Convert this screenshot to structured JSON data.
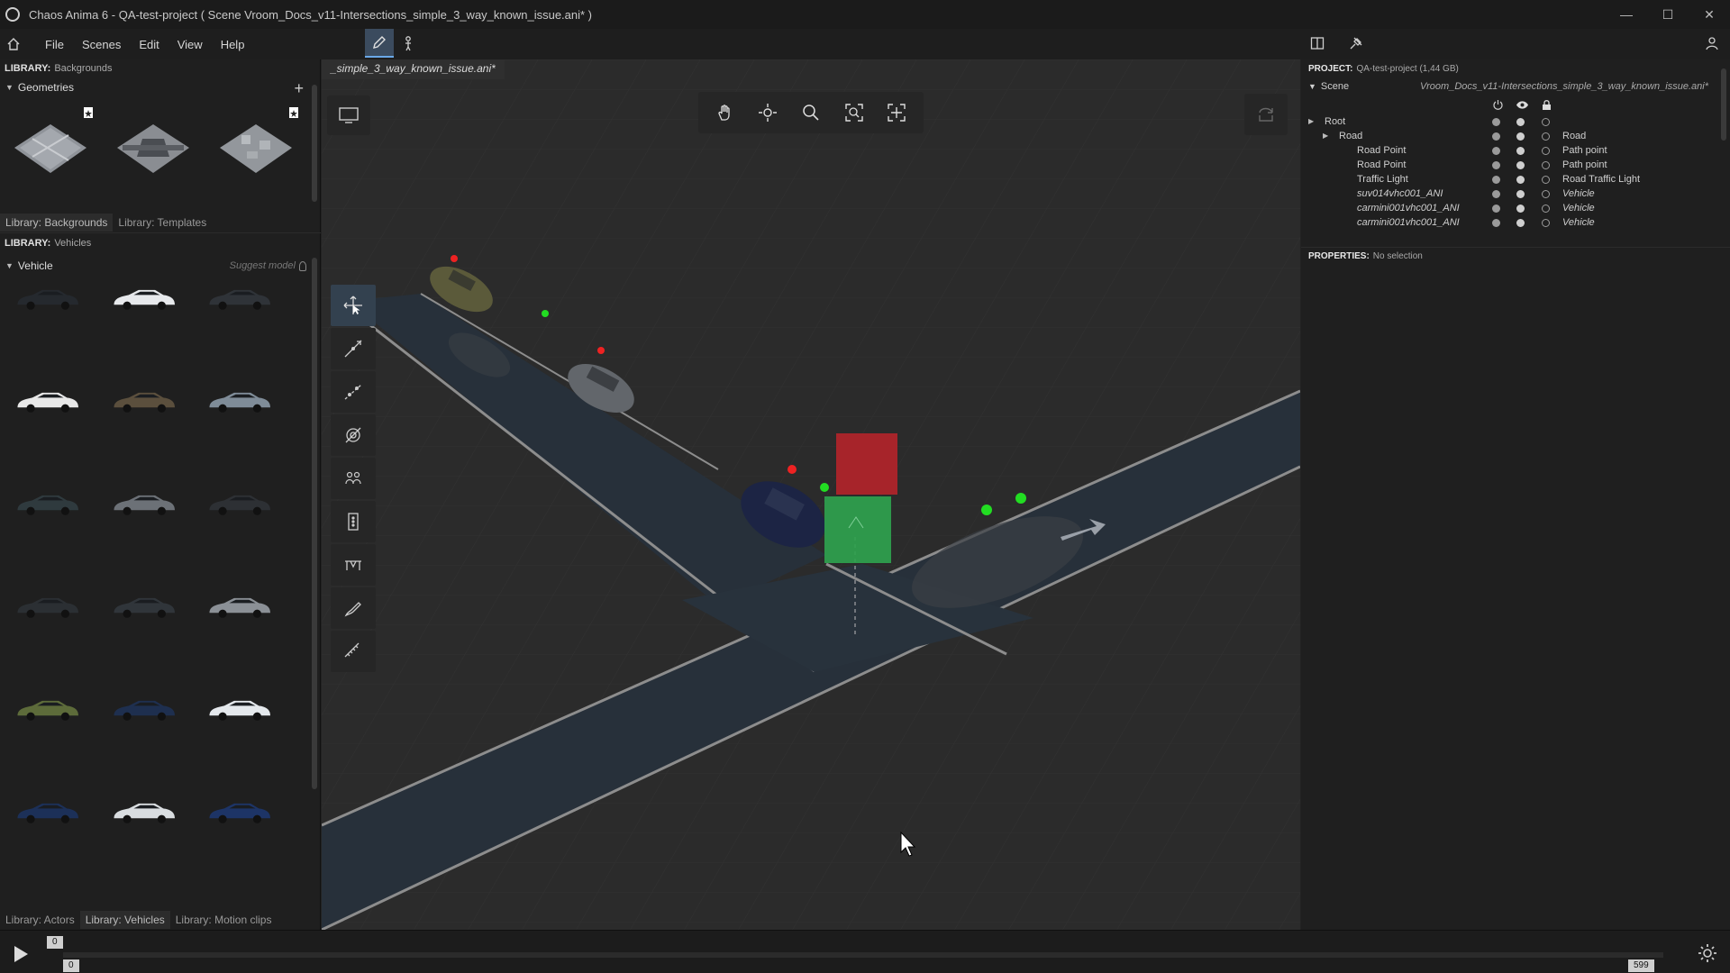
{
  "window": {
    "title": "Chaos Anima 6 - QA-test-project ( Scene Vroom_Docs_v11-Intersections_simple_3_way_known_issue.ani* )",
    "controls": [
      "minimize",
      "maximize",
      "close"
    ]
  },
  "menu": {
    "items": [
      "File",
      "Scenes",
      "Edit",
      "View",
      "Help"
    ]
  },
  "left": {
    "backgrounds_header": {
      "label": "LIBRARY:",
      "value": "Backgrounds"
    },
    "geometries_title": "Geometries",
    "backgrounds_tabs": [
      "Library: Backgrounds",
      "Library: Templates"
    ],
    "vehicles_header": {
      "label": "LIBRARY:",
      "value": "Vehicles"
    },
    "vehicle_title": "Vehicle",
    "suggest_model": "Suggest model",
    "vehicle_tabs": [
      "Library: Actors",
      "Library: Vehicles",
      "Library: Motion clips"
    ],
    "vehicle_colors": [
      [
        "#25292e",
        "#e7e9ec",
        "#2f3338"
      ],
      [
        "#e8e8e8",
        "#5b4f3d",
        "#7f8c98"
      ],
      [
        "#2f3a3e",
        "#6c7177",
        "#2d3034"
      ],
      [
        "#2b2f33",
        "#30353a",
        "#8b9096"
      ],
      [
        "#5d6b3a",
        "#1e2f4f",
        "#e4e8ec"
      ],
      [
        "#1c3058",
        "#d9dde0",
        "#1d3466"
      ]
    ]
  },
  "viewport": {
    "tab": "_simple_3_way_known_issue.ani*",
    "top_tools": [
      "hand-icon",
      "orbit-icon",
      "zoom-icon",
      "focus-icon",
      "frame-all-icon"
    ],
    "side_tools": [
      "select-move-icon",
      "path-tool-icon",
      "split-path-icon",
      "road-tool-icon",
      "crowd-tool-icon",
      "traffic-light-tool-icon",
      "barrier-tool-icon",
      "brush-tool-icon",
      "measure-tool-icon"
    ]
  },
  "right": {
    "project_header": {
      "label": "PROJECT:",
      "value": "QA-test-project (1,44 GB)"
    },
    "scene_label": "Scene",
    "scene_name": "Vroom_Docs_v11-Intersections_simple_3_way_known_issue.ani*",
    "tree": [
      {
        "label": "Root",
        "type": "",
        "italic": false
      },
      {
        "label": "Road",
        "type": "Road",
        "italic": false
      },
      {
        "label": "Road Point",
        "type": "Path point",
        "italic": false
      },
      {
        "label": "Road Point",
        "type": "Path point",
        "italic": false
      },
      {
        "label": "Traffic Light",
        "type": "Road Traffic Light",
        "italic": false
      },
      {
        "label": "suv014vhc001_ANI",
        "type": "Vehicle",
        "italic": true
      },
      {
        "label": "carmini001vhc001_ANI",
        "type": "Vehicle",
        "italic": true
      },
      {
        "label": "carmini001vhc001_ANI",
        "type": "Vehicle",
        "italic": true
      }
    ],
    "properties_header": {
      "label": "PROPERTIES:",
      "value": "No selection"
    }
  },
  "timeline": {
    "start_top": "0",
    "start_bottom": "0",
    "end": "599"
  }
}
